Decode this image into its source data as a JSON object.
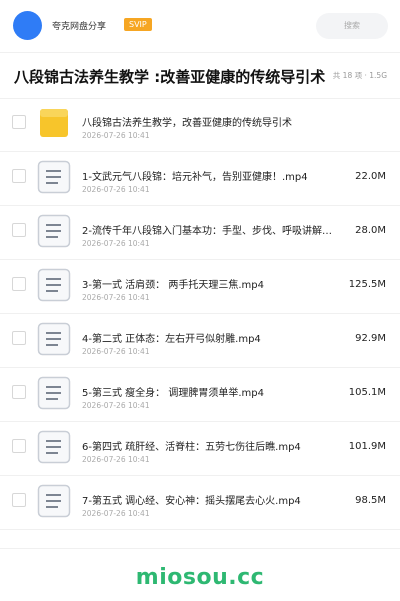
{
  "header": {
    "brand": "夸克网盘分享",
    "badge": "SVIP",
    "search_placeholder": "搜索"
  },
  "share": {
    "title": "八段锦古法养生教学 :改善亚健康的传统导引术",
    "meta": "共 18 项 · 1.5G"
  },
  "files": [
    {
      "type": "folder",
      "name": "八段锦古法养生教学，改善亚健康的传统导引术",
      "date": "2026-07-26 10:41",
      "size": ""
    },
    {
      "type": "file",
      "name": "1-文武元气八段锦：培元补气，告别亚健康！.mp4",
      "date": "2026-07-26 10:41",
      "size": "22.0M"
    },
    {
      "type": "file",
      "name": "2-流传千年八段锦入门基本功：手型、步伐、呼吸讲解…",
      "date": "2026-07-26 10:41",
      "size": "28.0M"
    },
    {
      "type": "file",
      "name": "3-第一式 活肩颈： 两手托天理三焦.mp4",
      "date": "2026-07-26 10:41",
      "size": "125.5M"
    },
    {
      "type": "file",
      "name": "4-第二式 正体态：左右开弓似射雕.mp4",
      "date": "2026-07-26 10:41",
      "size": "92.9M"
    },
    {
      "type": "file",
      "name": "5-第三式 瘦全身： 调理脾胃须单举.mp4",
      "date": "2026-07-26 10:41",
      "size": "105.1M"
    },
    {
      "type": "file",
      "name": "6-第四式 疏肝经、活脊柱：五劳七伤往后瞧.mp4",
      "date": "2026-07-26 10:41",
      "size": "101.9M"
    },
    {
      "type": "file",
      "name": "7-第五式 调心经、安心神：摇头摆尾去心火.mp4",
      "date": "2026-07-26 10:41",
      "size": "98.5M"
    }
  ],
  "footer": {
    "watermark": "miosou.cc"
  },
  "colors": {
    "accent": "#2f7cf6",
    "badge": "#f6a623",
    "folder": "#f7c52b",
    "watermark": "#2eb872"
  }
}
